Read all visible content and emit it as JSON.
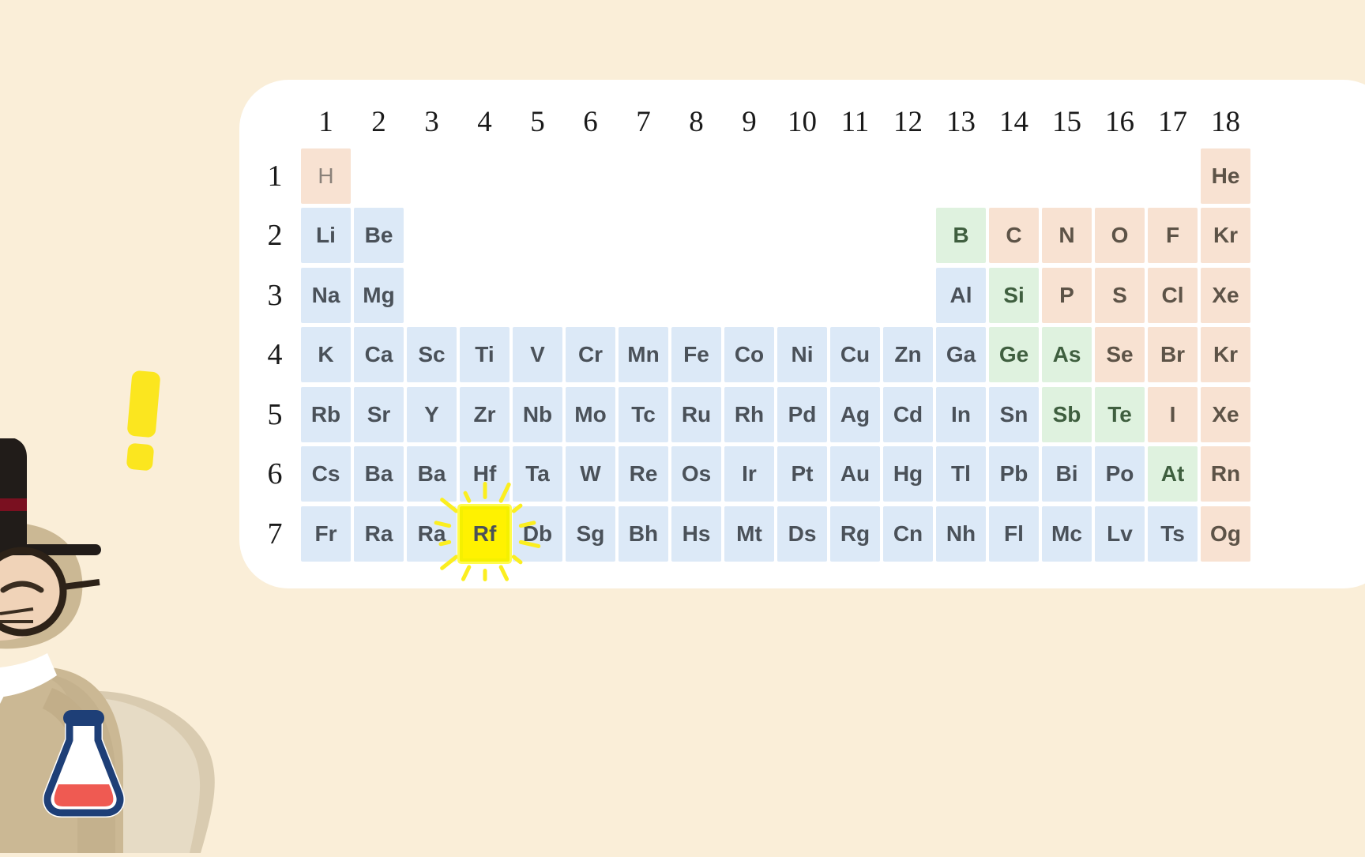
{
  "page": {
    "background_color": "#faeed8",
    "card_color": "#ffffff"
  },
  "periodic_table": {
    "group_headers": [
      "1",
      "2",
      "3",
      "4",
      "5",
      "6",
      "7",
      "8",
      "9",
      "10",
      "11",
      "12",
      "13",
      "14",
      "15",
      "16",
      "17",
      "18"
    ],
    "period_headers": [
      "1",
      "2",
      "3",
      "4",
      "5",
      "6",
      "7"
    ],
    "legend_colors": {
      "metal": "#dce9f7",
      "nonmetal": "#f8e2d2",
      "metalloid": "#dff2df",
      "highlight": "#fff200",
      "metal_text": "#4a5159",
      "nonmetal_text": "#5d5347",
      "metalloid_text": "#3f5f3f"
    },
    "selected_element": "Rf",
    "rows": [
      {
        "period": "1",
        "cells": [
          {
            "symbol": "H",
            "group": 1,
            "category": "hydrogen"
          },
          {
            "symbol": "He",
            "group": 18,
            "category": "nonmetal"
          }
        ]
      },
      {
        "period": "2",
        "cells": [
          {
            "symbol": "Li",
            "group": 1,
            "category": "metal"
          },
          {
            "symbol": "Be",
            "group": 2,
            "category": "metal"
          },
          {
            "symbol": "B",
            "group": 13,
            "category": "metalloid"
          },
          {
            "symbol": "C",
            "group": 14,
            "category": "nonmetal"
          },
          {
            "symbol": "N",
            "group": 15,
            "category": "nonmetal"
          },
          {
            "symbol": "O",
            "group": 16,
            "category": "nonmetal"
          },
          {
            "symbol": "F",
            "group": 17,
            "category": "nonmetal"
          },
          {
            "symbol": "Kr",
            "group": 18,
            "category": "nonmetal"
          }
        ]
      },
      {
        "period": "3",
        "cells": [
          {
            "symbol": "Na",
            "group": 1,
            "category": "metal"
          },
          {
            "symbol": "Mg",
            "group": 2,
            "category": "metal"
          },
          {
            "symbol": "Al",
            "group": 13,
            "category": "metal"
          },
          {
            "symbol": "Si",
            "group": 14,
            "category": "metalloid"
          },
          {
            "symbol": "P",
            "group": 15,
            "category": "nonmetal"
          },
          {
            "symbol": "S",
            "group": 16,
            "category": "nonmetal"
          },
          {
            "symbol": "Cl",
            "group": 17,
            "category": "nonmetal"
          },
          {
            "symbol": "Xe",
            "group": 18,
            "category": "nonmetal"
          }
        ]
      },
      {
        "period": "4",
        "cells": [
          {
            "symbol": "K",
            "group": 1,
            "category": "metal"
          },
          {
            "symbol": "Ca",
            "group": 2,
            "category": "metal"
          },
          {
            "symbol": "Sc",
            "group": 3,
            "category": "metal"
          },
          {
            "symbol": "Ti",
            "group": 4,
            "category": "metal"
          },
          {
            "symbol": "V",
            "group": 5,
            "category": "metal"
          },
          {
            "symbol": "Cr",
            "group": 6,
            "category": "metal"
          },
          {
            "symbol": "Mn",
            "group": 7,
            "category": "metal"
          },
          {
            "symbol": "Fe",
            "group": 8,
            "category": "metal"
          },
          {
            "symbol": "Co",
            "group": 9,
            "category": "metal"
          },
          {
            "symbol": "Ni",
            "group": 10,
            "category": "metal"
          },
          {
            "symbol": "Cu",
            "group": 11,
            "category": "metal"
          },
          {
            "symbol": "Zn",
            "group": 12,
            "category": "metal"
          },
          {
            "symbol": "Ga",
            "group": 13,
            "category": "metal"
          },
          {
            "symbol": "Ge",
            "group": 14,
            "category": "metalloid"
          },
          {
            "symbol": "As",
            "group": 15,
            "category": "metalloid"
          },
          {
            "symbol": "Se",
            "group": 16,
            "category": "nonmetal"
          },
          {
            "symbol": "Br",
            "group": 17,
            "category": "nonmetal"
          },
          {
            "symbol": "Kr",
            "group": 18,
            "category": "nonmetal"
          }
        ]
      },
      {
        "period": "5",
        "cells": [
          {
            "symbol": "Rb",
            "group": 1,
            "category": "metal"
          },
          {
            "symbol": "Sr",
            "group": 2,
            "category": "metal"
          },
          {
            "symbol": "Y",
            "group": 3,
            "category": "metal"
          },
          {
            "symbol": "Zr",
            "group": 4,
            "category": "metal"
          },
          {
            "symbol": "Nb",
            "group": 5,
            "category": "metal"
          },
          {
            "symbol": "Mo",
            "group": 6,
            "category": "metal"
          },
          {
            "symbol": "Tc",
            "group": 7,
            "category": "metal"
          },
          {
            "symbol": "Ru",
            "group": 8,
            "category": "metal"
          },
          {
            "symbol": "Rh",
            "group": 9,
            "category": "metal"
          },
          {
            "symbol": "Pd",
            "group": 10,
            "category": "metal"
          },
          {
            "symbol": "Ag",
            "group": 11,
            "category": "metal"
          },
          {
            "symbol": "Cd",
            "group": 12,
            "category": "metal"
          },
          {
            "symbol": "In",
            "group": 13,
            "category": "metal"
          },
          {
            "symbol": "Sn",
            "group": 14,
            "category": "metal"
          },
          {
            "symbol": "Sb",
            "group": 15,
            "category": "metalloid"
          },
          {
            "symbol": "Te",
            "group": 16,
            "category": "metalloid"
          },
          {
            "symbol": "I",
            "group": 17,
            "category": "nonmetal"
          },
          {
            "symbol": "Xe",
            "group": 18,
            "category": "nonmetal"
          }
        ]
      },
      {
        "period": "6",
        "cells": [
          {
            "symbol": "Cs",
            "group": 1,
            "category": "metal"
          },
          {
            "symbol": "Ba",
            "group": 2,
            "category": "metal"
          },
          {
            "symbol": "Ba",
            "group": 3,
            "category": "metal"
          },
          {
            "symbol": "Hf",
            "group": 4,
            "category": "metal"
          },
          {
            "symbol": "Ta",
            "group": 5,
            "category": "metal"
          },
          {
            "symbol": "W",
            "group": 6,
            "category": "metal"
          },
          {
            "symbol": "Re",
            "group": 7,
            "category": "metal"
          },
          {
            "symbol": "Os",
            "group": 8,
            "category": "metal"
          },
          {
            "symbol": "Ir",
            "group": 9,
            "category": "metal"
          },
          {
            "symbol": "Pt",
            "group": 10,
            "category": "metal"
          },
          {
            "symbol": "Au",
            "group": 11,
            "category": "metal"
          },
          {
            "symbol": "Hg",
            "group": 12,
            "category": "metal"
          },
          {
            "symbol": "Tl",
            "group": 13,
            "category": "metal"
          },
          {
            "symbol": "Pb",
            "group": 14,
            "category": "metal"
          },
          {
            "symbol": "Bi",
            "group": 15,
            "category": "metal"
          },
          {
            "symbol": "Po",
            "group": 16,
            "category": "metal"
          },
          {
            "symbol": "At",
            "group": 17,
            "category": "metalloid"
          },
          {
            "symbol": "Rn",
            "group": 18,
            "category": "nonmetal"
          }
        ]
      },
      {
        "period": "7",
        "cells": [
          {
            "symbol": "Fr",
            "group": 1,
            "category": "metal"
          },
          {
            "symbol": "Ra",
            "group": 2,
            "category": "metal"
          },
          {
            "symbol": "Ra",
            "group": 3,
            "category": "metal"
          },
          {
            "symbol": "Rf",
            "group": 4,
            "category": "metal",
            "highlight": true
          },
          {
            "symbol": "Db",
            "group": 5,
            "category": "metal"
          },
          {
            "symbol": "Sg",
            "group": 6,
            "category": "metal"
          },
          {
            "symbol": "Bh",
            "group": 7,
            "category": "metal"
          },
          {
            "symbol": "Hs",
            "group": 8,
            "category": "metal"
          },
          {
            "symbol": "Mt",
            "group": 9,
            "category": "metal"
          },
          {
            "symbol": "Ds",
            "group": 10,
            "category": "metal"
          },
          {
            "symbol": "Rg",
            "group": 11,
            "category": "metal"
          },
          {
            "symbol": "Cn",
            "group": 12,
            "category": "metal"
          },
          {
            "symbol": "Nh",
            "group": 13,
            "category": "metal"
          },
          {
            "symbol": "Fl",
            "group": 14,
            "category": "metal"
          },
          {
            "symbol": "Mc",
            "group": 15,
            "category": "metal"
          },
          {
            "symbol": "Lv",
            "group": 16,
            "category": "metal"
          },
          {
            "symbol": "Ts",
            "group": 17,
            "category": "metal"
          },
          {
            "symbol": "Og",
            "group": 18,
            "category": "nonmetal"
          }
        ]
      }
    ]
  },
  "mascot": {
    "description": "cat-scientist",
    "hat_color": "#211c19",
    "hat_band_color": "#7a1020",
    "fur_color": "#cbb894",
    "face_color": "#f0d3b8",
    "scarf_color": "#ffffff",
    "flask_outline_color": "#1e3f77",
    "flask_liquid_color": "#ef5a52",
    "exclamation_color": "#fbe61f"
  }
}
